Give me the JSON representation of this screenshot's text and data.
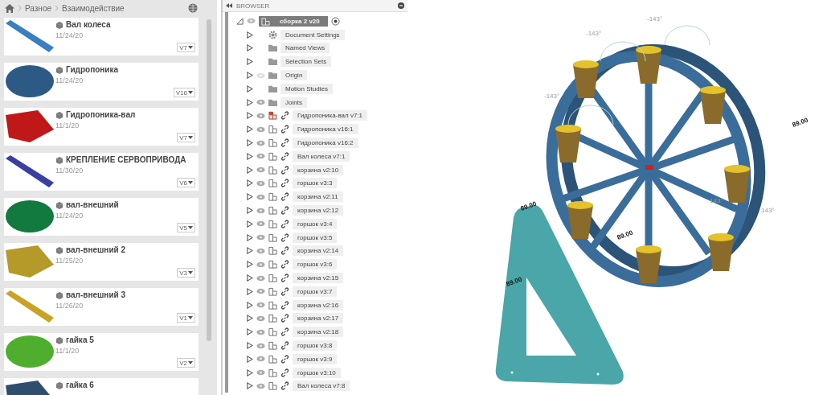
{
  "breadcrumb": [
    "Разное",
    "Взаимодействие"
  ],
  "files": [
    {
      "name": "Вал колеса",
      "date": "11/24/20",
      "version": "V7",
      "color": "#3a7fc0"
    },
    {
      "name": "Гидропоника",
      "date": "11/24/20",
      "version": "V16",
      "color": "#2d5a85"
    },
    {
      "name": "Гидропоника-вал",
      "date": "11/1/20",
      "version": "V7",
      "color": "#c01818"
    },
    {
      "name": "КРЕПЛЕНИЕ СЕРВОПРИВОДА",
      "date": "11/30/20",
      "version": "V6",
      "color": "#3a3fa0"
    },
    {
      "name": "вал-внешний",
      "date": "11/24/20",
      "version": "V5",
      "color": "#127a3e"
    },
    {
      "name": "вал-внешний 2",
      "date": "11/25/20",
      "version": "V3",
      "color": "#b59a2a"
    },
    {
      "name": "вал-внешний 3",
      "date": "11/26/20",
      "version": "V1",
      "color": "#c9a227"
    },
    {
      "name": "гайка 5",
      "date": "11/1/20",
      "version": "V2",
      "color": "#4fae2e"
    },
    {
      "name": "гайка 6",
      "color": "#2f4e6e"
    }
  ],
  "browser": {
    "title": "BROWSER",
    "root": {
      "label": "сборка 2 v20"
    },
    "items": [
      {
        "kind": "settings",
        "label": "Document Settings"
      },
      {
        "kind": "folder",
        "label": "Named Views"
      },
      {
        "kind": "folder",
        "label": "Selection Sets"
      },
      {
        "kind": "folder",
        "label": "Origin",
        "visible": false
      },
      {
        "kind": "folder",
        "label": "Motion Studies"
      },
      {
        "kind": "folder",
        "label": "Joints",
        "visible": true
      },
      {
        "kind": "component",
        "label": "Гидропоника-вал v7:1",
        "visible": true,
        "grounded": true
      },
      {
        "kind": "component",
        "label": "Гидропоника v16:1",
        "visible": true,
        "grounded": false
      },
      {
        "kind": "component",
        "label": "Гидропоника v16:2",
        "visible": true,
        "grounded": false
      },
      {
        "kind": "component",
        "label": "Вал колеса v7:1",
        "visible": true,
        "grounded": false
      },
      {
        "kind": "component",
        "label": "корзина v2:10",
        "visible": true,
        "grounded": false
      },
      {
        "kind": "component",
        "label": "горшок v3:3",
        "visible": true,
        "grounded": false
      },
      {
        "kind": "component",
        "label": "корзина v2:11",
        "visible": true,
        "grounded": false
      },
      {
        "kind": "component",
        "label": "корзина v2:12",
        "visible": true,
        "grounded": false
      },
      {
        "kind": "component",
        "label": "горшок v3:4",
        "visible": true,
        "grounded": false
      },
      {
        "kind": "component",
        "label": "горшок v3:5",
        "visible": true,
        "grounded": false
      },
      {
        "kind": "component",
        "label": "корзина v2:14",
        "visible": true,
        "grounded": false
      },
      {
        "kind": "component",
        "label": "горшок v3:6",
        "visible": true,
        "grounded": false
      },
      {
        "kind": "component",
        "label": "корзина v2:15",
        "visible": true,
        "grounded": false
      },
      {
        "kind": "component",
        "label": "горшок v3:7",
        "visible": true,
        "grounded": false
      },
      {
        "kind": "component",
        "label": "корзина v2:16",
        "visible": true,
        "grounded": false
      },
      {
        "kind": "component",
        "label": "корзина v2:17",
        "visible": true,
        "grounded": false
      },
      {
        "kind": "component",
        "label": "корзина v2:18",
        "visible": true,
        "grounded": false
      },
      {
        "kind": "component",
        "label": "горшок v3:8",
        "visible": true,
        "grounded": false
      },
      {
        "kind": "component",
        "label": "горшок v3:9",
        "visible": true,
        "grounded": false
      },
      {
        "kind": "component",
        "label": "горшок v3:10",
        "visible": true,
        "grounded": false
      },
      {
        "kind": "component",
        "label": "Вал колеса v7:8",
        "visible": true,
        "grounded": false
      }
    ]
  },
  "viewport": {
    "dimension_labels": [
      "-143°",
      "-143°",
      "-143°",
      "143°",
      "143°",
      "89.00",
      "89.00",
      "89.00",
      "89.00"
    ]
  }
}
